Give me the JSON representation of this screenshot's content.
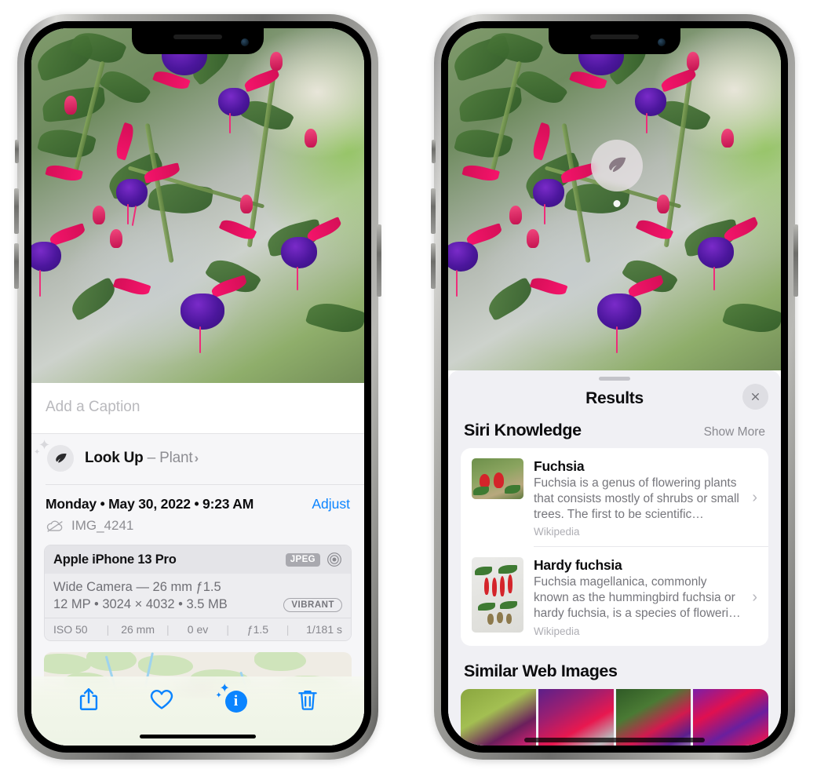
{
  "left_phone": {
    "photo": {
      "alt": "fuchsia-flowers-photo"
    },
    "caption_field": {
      "placeholder": "Add a Caption",
      "value": ""
    },
    "look_up": {
      "icon": "leaf-icon",
      "label": "Look Up",
      "dash": " – ",
      "subject": "Plant",
      "chevron": "›"
    },
    "metadata": {
      "date": "Monday • May 30, 2022 • 9:23 AM",
      "adjust_label": "Adjust",
      "cloud_icon": "cloud-slash-icon",
      "filename": "IMG_4241"
    },
    "camera_card": {
      "model": "Apple iPhone 13 Pro",
      "format_badge": "JPEG",
      "aperture_icon": "aperture-icon",
      "lens_line": "Wide Camera — 26 mm ƒ1.5",
      "specs_line": "12 MP • 3024 × 4032 • 3.5 MB",
      "style_badge": "VIBRANT",
      "exif": [
        "ISO 50",
        "26 mm",
        "0 ev",
        "ƒ1.5",
        "1/181 s"
      ],
      "exif_separator": "|"
    },
    "map": {
      "pin": "photo-pin"
    },
    "toolbar": [
      {
        "name": "share-icon",
        "label": "Share"
      },
      {
        "name": "heart-icon",
        "label": "Favorite"
      },
      {
        "name": "info-sparkle-icon",
        "label": "Info",
        "glyph": "i"
      },
      {
        "name": "trash-icon",
        "label": "Delete"
      }
    ]
  },
  "right_phone": {
    "photo": {
      "alt": "fuchsia-flowers-photo"
    },
    "leaf_pin": {
      "icon": "leaf-icon"
    },
    "sheet": {
      "grabber": true,
      "title": "Results",
      "close_icon": "close-icon"
    },
    "siri_knowledge": {
      "section_title": "Siri Knowledge",
      "show_more": "Show More",
      "items": [
        {
          "thumb": "fuchsia-flowers-thumb",
          "title": "Fuchsia",
          "description": "Fuchsia is a genus of flowering plants that consists mostly of shrubs or small trees. The first to be scientific…",
          "source": "Wikipedia",
          "chevron": "›"
        },
        {
          "thumb": "hardy-fuchsia-specimen-thumb",
          "title": "Hardy fuchsia",
          "description": "Fuchsia magellanica, commonly known as the hummingbird fuchsia or hardy fuchsia, is a species of floweri…",
          "source": "Wikipedia",
          "chevron": "›"
        }
      ]
    },
    "similar_web_images": {
      "section_title": "Similar Web Images",
      "thumbs": [
        "fuchsia-web-image-1",
        "fuchsia-web-image-2",
        "fuchsia-web-image-3",
        "fuchsia-web-image-4"
      ]
    }
  },
  "colors": {
    "accent_blue": "#0b84ff",
    "sheet_bg": "#f0f0f4",
    "card_bg": "#ffffff",
    "secondary_text": "#8e8e93",
    "chassis_silver": "#b9b9b5"
  }
}
